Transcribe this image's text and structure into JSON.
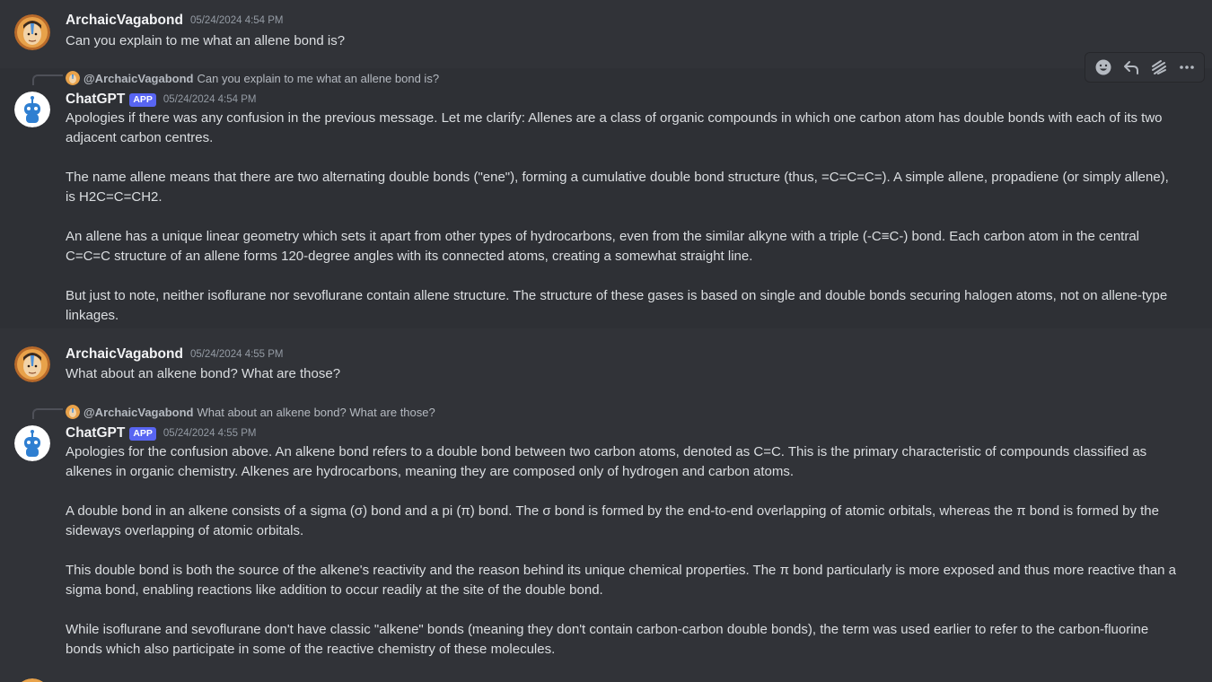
{
  "messages": [
    {
      "author": "ArchaicVagabond",
      "timestamp": "05/24/2024 4:54 PM",
      "text": "Can you explain to me what an allene bond is?"
    },
    {
      "reply": {
        "mention": "@ArchaicVagabond",
        "text": "Can you explain to me what an allene bond is?"
      },
      "author": "ChatGPT",
      "tag": "APP",
      "timestamp": "05/24/2024 4:54 PM",
      "paragraphs": [
        "Apologies if there was any confusion in the previous message. Let me clarify: Allenes are a class of organic compounds in which one carbon atom has double bonds with each of its two adjacent carbon centres.",
        "The name allene means that there are two alternating double bonds (\"ene\"), forming a cumulative double bond structure (thus, =C=C=C=). A simple allene, propadiene (or simply allene), is H2C=C=CH2.",
        "An allene has a unique linear geometry which sets it apart from other types of hydrocarbons, even from the similar alkyne with a triple (-C≡C-) bond. Each carbon atom in the central C=C=C structure of an allene forms 120-degree angles with its connected atoms, creating a somewhat straight line.",
        "But just to note, neither isoflurane nor sevoflurane contain allene structure. The structure of these gases is based on single and double bonds securing halogen atoms, not on allene-type linkages."
      ]
    },
    {
      "author": "ArchaicVagabond",
      "timestamp": "05/24/2024 4:55 PM",
      "text": "What about an alkene bond? What are those?"
    },
    {
      "reply": {
        "mention": "@ArchaicVagabond",
        "text": "What about an alkene bond? What are those?"
      },
      "author": "ChatGPT",
      "tag": "APP",
      "timestamp": "05/24/2024 4:55 PM",
      "paragraphs": [
        "Apologies for the confusion above. An alkene bond refers to a double bond between two carbon atoms, denoted as C=C. This is the primary characteristic of compounds classified as alkenes in organic chemistry. Alkenes are hydrocarbons, meaning they are composed only of hydrogen and carbon atoms.",
        "A double bond in an alkene consists of a sigma (σ) bond and a pi (π) bond. The σ bond is formed by the end-to-end overlapping of atomic orbitals, whereas the π bond is formed by the sideways overlapping of atomic orbitals.",
        "This double bond is both the source of the alkene's reactivity and the reason behind its unique chemical properties. The π bond particularly is more exposed and thus more reactive than a sigma bond, enabling reactions like addition to occur readily at the site of the double bond.",
        "While isoflurane and sevoflurane don't have classic \"alkene\" bonds (meaning they don't contain carbon-carbon double bonds), the term was used earlier to refer to the carbon-fluorine bonds which also participate in some of the reactive chemistry of these molecules."
      ]
    }
  ],
  "toolbar": {
    "icons": [
      "add-reaction-icon",
      "reply-icon",
      "create-thread-icon",
      "more-icon"
    ]
  },
  "colors": {
    "background": "#313338",
    "hover_background": "#2e3035",
    "app_tag": "#5865f2",
    "username": "#f2f3f5",
    "text": "#dbdee1",
    "muted": "#949ba4"
  }
}
